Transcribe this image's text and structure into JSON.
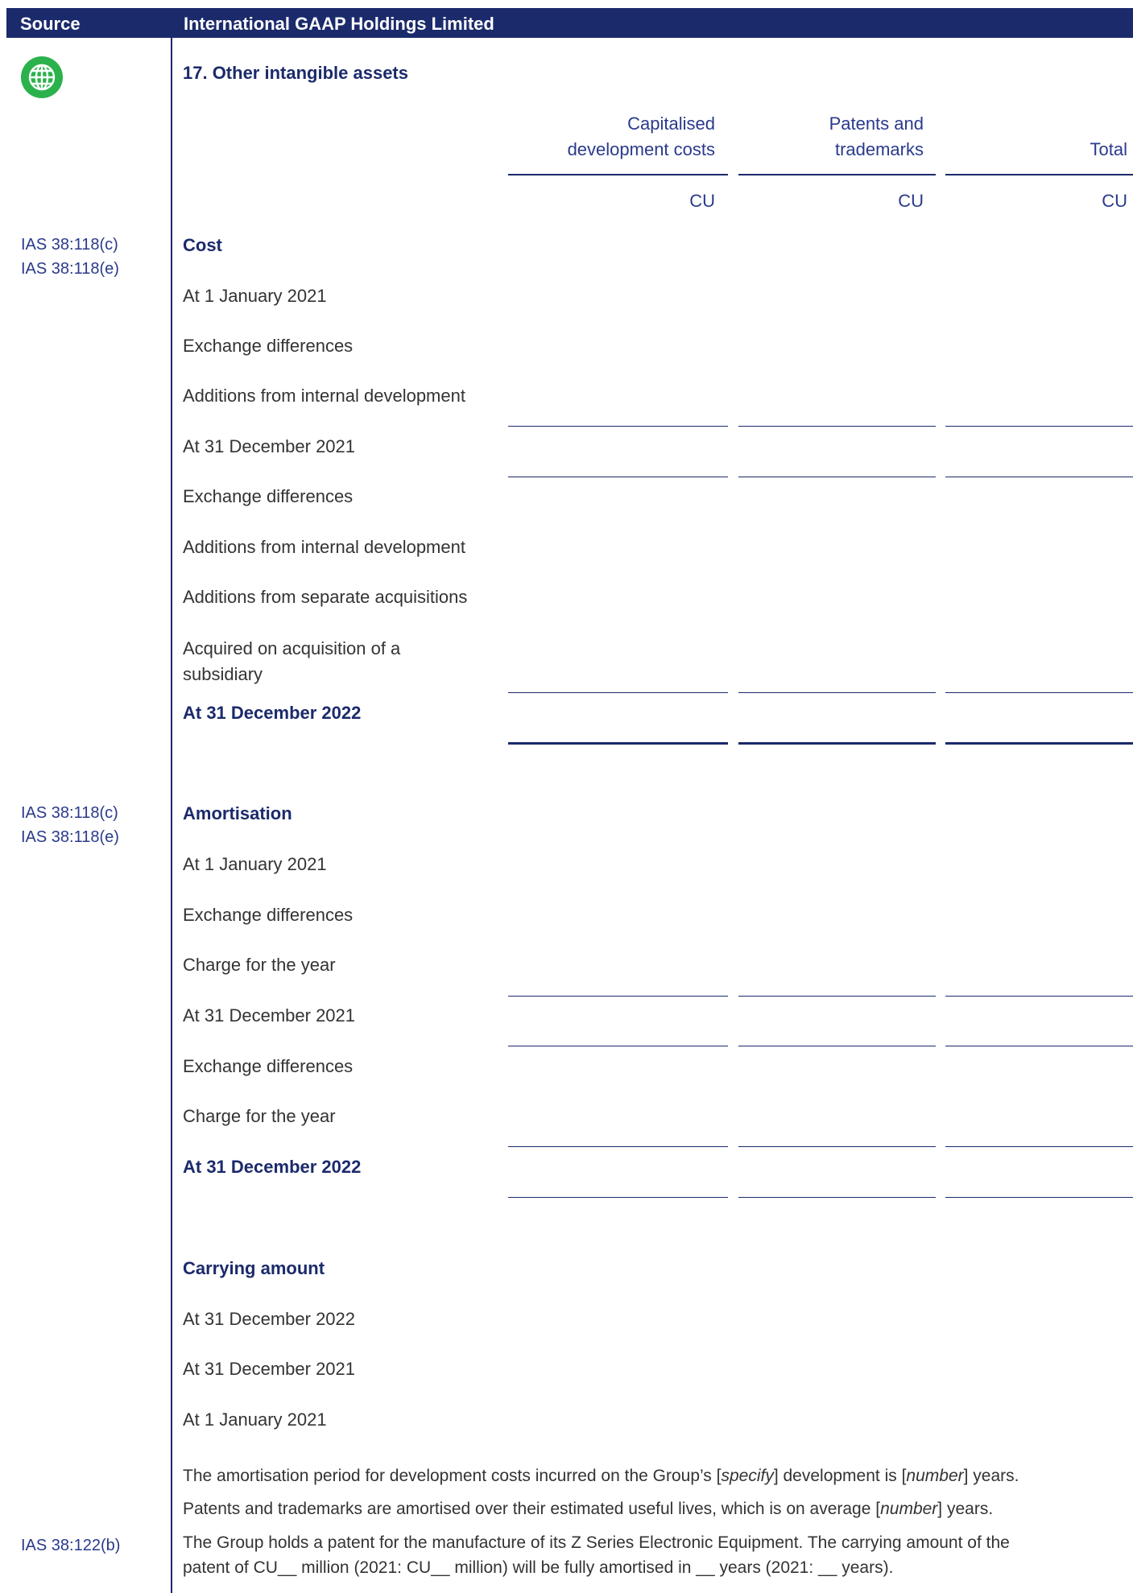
{
  "header": {
    "source_label": "Source",
    "entity": "International GAAP Holdings Limited"
  },
  "note_title": "17. Other intangible assets",
  "columns": [
    {
      "line1": "Capitalised",
      "line2": "development costs",
      "unit": "CU"
    },
    {
      "line1": "Patents and",
      "line2": "trademarks",
      "unit": "CU"
    },
    {
      "line1": "",
      "line2": "Total",
      "unit": "CU"
    }
  ],
  "cost": {
    "refs": [
      "IAS 38:118(c)",
      "IAS 38:118(e)"
    ],
    "heading": "Cost",
    "rows": [
      "At 1 January 2021",
      "Exchange differences",
      "Additions from internal development",
      "At 31 December 2021",
      "Exchange differences",
      "Additions from internal development",
      "Additions from separate acquisitions",
      "Acquired on acquisition of a",
      "subsidiary"
    ],
    "closing": "At 31 December 2022"
  },
  "amortisation": {
    "refs": [
      "IAS 38:118(c)",
      "IAS 38:118(e)"
    ],
    "heading": "Amortisation",
    "rows": [
      "At 1 January 2021",
      "Exchange differences",
      "Charge for the year",
      "At 31 December 2021",
      "Exchange differences",
      "Charge for the year"
    ],
    "closing": "At 31 December 2022"
  },
  "carrying": {
    "heading": "Carrying amount",
    "rows": [
      "At 31 December 2022",
      "At 31 December 2021",
      "At 1 January 2021"
    ]
  },
  "paragraphs": {
    "p1_a": "The amortisation period for development costs incurred on the Group’s [",
    "p1_b": "specify",
    "p1_c": "] development is [",
    "p1_d": "number",
    "p1_e": "] years.",
    "p2_a": "Patents and trademarks are amortised over their estimated useful lives, which is on average [",
    "p2_b": "number",
    "p2_c": "] years.",
    "p3_ref": "IAS 38:122(b)",
    "p3_line1": "The Group holds a patent for the manufacture of its Z Series Electronic Equipment. The carrying amount of the",
    "p3_line2": "patent of CU__ million (2021: CU__ million) will be fully amortised in __ years (2021: __ years)."
  },
  "colors": {
    "navy": "#1b2a6b",
    "link_blue": "#2a3a8c",
    "globe_green": "#2bb24c"
  },
  "icons": {
    "globe": "globe-icon"
  }
}
